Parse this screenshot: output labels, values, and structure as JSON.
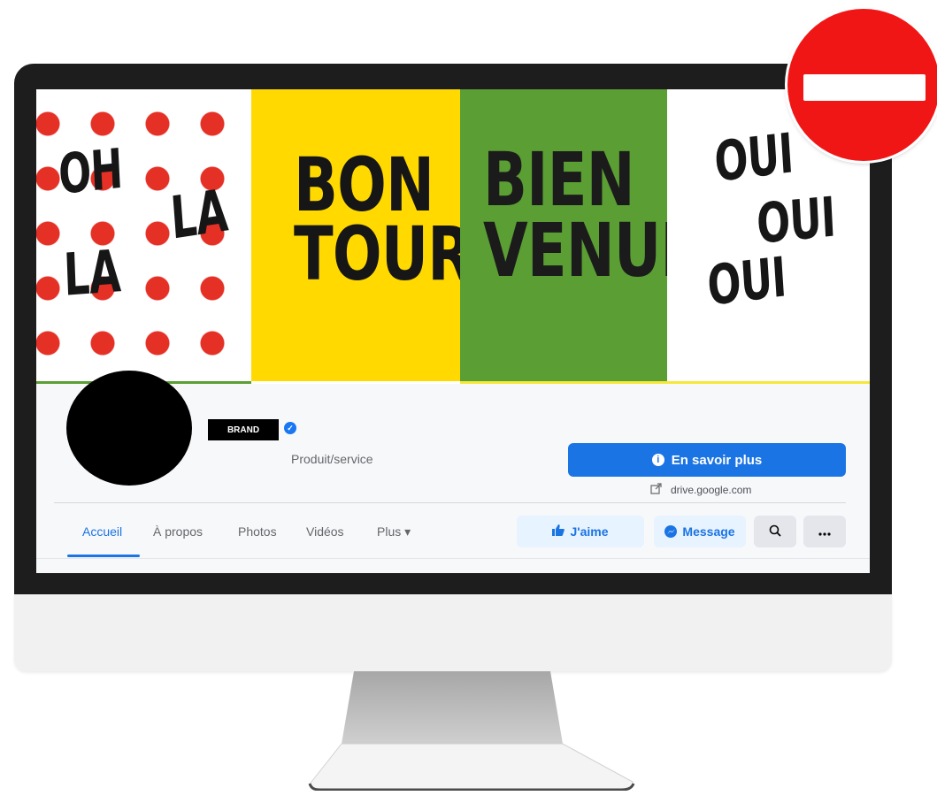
{
  "cover": {
    "panel1": {
      "line1": "OH",
      "line2": "LA",
      "line3": "LA"
    },
    "panel2": {
      "line1": "BON",
      "line2": "TOUR"
    },
    "panel3": {
      "line1": "BIEN",
      "line2": "VENUE"
    },
    "panel4": {
      "line1": "OUI",
      "line2": "OUI",
      "line3": "OUI"
    }
  },
  "profile": {
    "brand_label": "BRAND",
    "verified_icon": "verified-check-icon",
    "category": "Produit/service",
    "cta_label": "En savoir plus",
    "cta_icon": "info-icon",
    "link_icon": "external-link-icon",
    "link_text": "drive.google.com"
  },
  "tabs": [
    {
      "label": "Accueil",
      "active": true
    },
    {
      "label": "À propos"
    },
    {
      "label": "Photos"
    },
    {
      "label": "Vidéos"
    },
    {
      "label": "Plus ▾"
    }
  ],
  "actions": {
    "like_label": "J'aime",
    "like_icon": "thumbs-up-icon",
    "message_label": "Message",
    "message_icon": "messenger-icon",
    "search_icon": "search-icon",
    "more_icon": "more-icon"
  },
  "colors": {
    "facebook_blue": "#1b74e4",
    "cover_red": "#e53026",
    "cover_yellow": "#ffd900",
    "cover_green": "#5a9e34",
    "no_entry_red": "#f11616"
  }
}
